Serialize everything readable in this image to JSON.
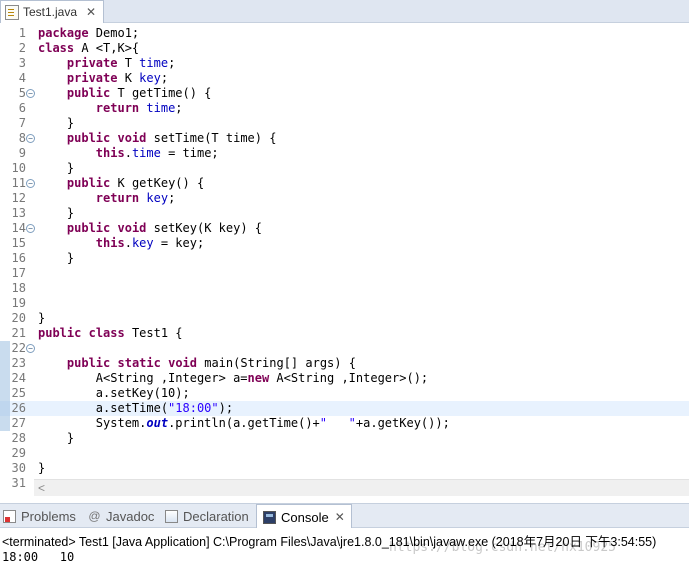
{
  "editor_tab": {
    "title": "Test1.java",
    "close": "✕",
    "icon": "java-file-icon"
  },
  "code_lines": [
    [
      {
        "t": "package",
        "c": "k"
      },
      {
        "t": " Demo1;"
      }
    ],
    [
      {
        "t": "class",
        "c": "k"
      },
      {
        "t": " A <T,K>{"
      }
    ],
    [
      {
        "t": "    "
      },
      {
        "t": "private",
        "c": "k"
      },
      {
        "t": " T "
      },
      {
        "t": "time",
        "c": "f"
      },
      {
        "t": ";"
      }
    ],
    [
      {
        "t": "    "
      },
      {
        "t": "private",
        "c": "k"
      },
      {
        "t": " K "
      },
      {
        "t": "key",
        "c": "f"
      },
      {
        "t": ";"
      }
    ],
    [
      {
        "t": "    "
      },
      {
        "t": "public",
        "c": "k"
      },
      {
        "t": " T getTime() {"
      }
    ],
    [
      {
        "t": "        "
      },
      {
        "t": "return",
        "c": "k"
      },
      {
        "t": " "
      },
      {
        "t": "time",
        "c": "f"
      },
      {
        "t": ";"
      }
    ],
    [
      {
        "t": "    }"
      }
    ],
    [
      {
        "t": "    "
      },
      {
        "t": "public",
        "c": "k"
      },
      {
        "t": " "
      },
      {
        "t": "void",
        "c": "k"
      },
      {
        "t": " setTime(T time) {"
      }
    ],
    [
      {
        "t": "        "
      },
      {
        "t": "this",
        "c": "k"
      },
      {
        "t": "."
      },
      {
        "t": "time",
        "c": "f"
      },
      {
        "t": " = time;"
      }
    ],
    [
      {
        "t": "    }"
      }
    ],
    [
      {
        "t": "    "
      },
      {
        "t": "public",
        "c": "k"
      },
      {
        "t": " K getKey() {"
      }
    ],
    [
      {
        "t": "        "
      },
      {
        "t": "return",
        "c": "k"
      },
      {
        "t": " "
      },
      {
        "t": "key",
        "c": "f"
      },
      {
        "t": ";"
      }
    ],
    [
      {
        "t": "    }"
      }
    ],
    [
      {
        "t": "    "
      },
      {
        "t": "public",
        "c": "k"
      },
      {
        "t": " "
      },
      {
        "t": "void",
        "c": "k"
      },
      {
        "t": " setKey(K key) {"
      }
    ],
    [
      {
        "t": "        "
      },
      {
        "t": "this",
        "c": "k"
      },
      {
        "t": "."
      },
      {
        "t": "key",
        "c": "f"
      },
      {
        "t": " = key;"
      }
    ],
    [
      {
        "t": "    }"
      }
    ],
    [],
    [],
    [],
    [
      {
        "t": "}"
      }
    ],
    [
      {
        "t": "public",
        "c": "k"
      },
      {
        "t": " "
      },
      {
        "t": "class",
        "c": "k"
      },
      {
        "t": " Test1 {"
      }
    ],
    [],
    [
      {
        "t": "    "
      },
      {
        "t": "public",
        "c": "k"
      },
      {
        "t": " "
      },
      {
        "t": "static",
        "c": "k"
      },
      {
        "t": " "
      },
      {
        "t": "void",
        "c": "k"
      },
      {
        "t": " main(String[] args) {"
      }
    ],
    [
      {
        "t": "        A<String ,Integer> a="
      },
      {
        "t": "new",
        "c": "k"
      },
      {
        "t": " A<String ,Integer>();"
      }
    ],
    [
      {
        "t": "        a.setKey(10);"
      }
    ],
    [
      {
        "t": "        a.setTime("
      },
      {
        "t": "\"18:00\"",
        "c": "s"
      },
      {
        "t": ");"
      }
    ],
    [
      {
        "t": "        System."
      },
      {
        "t": "out",
        "c": "fi"
      },
      {
        "t": ".println(a.getTime()+"
      },
      {
        "t": "\"   \"",
        "c": "s"
      },
      {
        "t": "+a.getKey());"
      }
    ],
    [
      {
        "t": "    }"
      }
    ],
    [],
    [
      {
        "t": "}"
      }
    ],
    []
  ],
  "fold_lines": [
    5,
    8,
    11,
    14,
    22
  ],
  "current_line": 26,
  "marked_lines": [
    22,
    23,
    24,
    25,
    26,
    27
  ],
  "hscroll": {
    "arrow": "<"
  },
  "panel_tabs": [
    {
      "label": "Problems",
      "icon": "problems-icon",
      "active": false
    },
    {
      "label": "Javadoc",
      "icon": "javadoc-icon",
      "active": false
    },
    {
      "label": "Declaration",
      "icon": "declaration-icon",
      "active": false
    },
    {
      "label": "Console",
      "icon": "console-icon",
      "active": true,
      "close": "✕"
    }
  ],
  "console": {
    "terminated": "<terminated> Test1 [Java Application] C:\\Program Files\\Java\\jre1.8.0_181\\bin\\javaw.exe (2018年7月20日 下午3:54:55)",
    "watermark": "https://blog.csdn.net/hx10925",
    "output": "18:00   10"
  }
}
